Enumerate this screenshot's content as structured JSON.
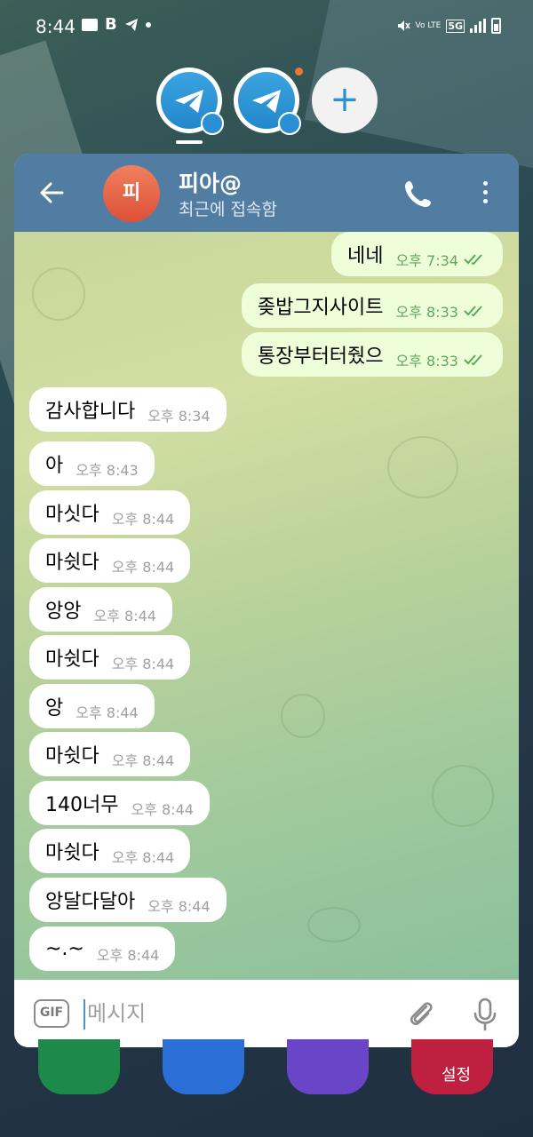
{
  "status_bar": {
    "time": "8:44",
    "network": "5G"
  },
  "chat": {
    "avatar_initial": "피",
    "name": "피아@",
    "status": "최근에 접속함"
  },
  "messages": [
    {
      "dir": "out",
      "text": "네네",
      "time": "오후 7:34"
    },
    {
      "dir": "out",
      "text": "좆밥그지사이트",
      "time": "오후 8:33"
    },
    {
      "dir": "out",
      "text": "통장부터터줬으",
      "time": "오후 8:33"
    },
    {
      "dir": "in",
      "text": "감사합니다",
      "time": "오후 8:34"
    },
    {
      "dir": "in",
      "text": "아",
      "time": "오후 8:43"
    },
    {
      "dir": "in",
      "text": "마싯다",
      "time": "오후 8:44"
    },
    {
      "dir": "in",
      "text": "마쉿다",
      "time": "오후 8:44"
    },
    {
      "dir": "in",
      "text": "앙앙",
      "time": "오후 8:44"
    },
    {
      "dir": "in",
      "text": "마쉿다",
      "time": "오후 8:44"
    },
    {
      "dir": "in",
      "text": "앙",
      "time": "오후 8:44"
    },
    {
      "dir": "in",
      "text": "마쉿다",
      "time": "오후 8:44"
    },
    {
      "dir": "in",
      "text": "140너무",
      "time": "오후 8:44"
    },
    {
      "dir": "in",
      "text": "마쉿다",
      "time": "오후 8:44"
    },
    {
      "dir": "in",
      "text": "앙달다달아",
      "time": "오후 8:44"
    },
    {
      "dir": "in",
      "text": "~.~",
      "time": "오후 8:44"
    }
  ],
  "input": {
    "gif_label": "GIF",
    "placeholder": "메시지"
  },
  "dock": {
    "settings_label": "설정"
  },
  "colors": {
    "header": "#527da3",
    "outgoing_bubble": "#eefed9",
    "incoming_bubble": "#ffffff",
    "avatar": "#e8664a"
  }
}
